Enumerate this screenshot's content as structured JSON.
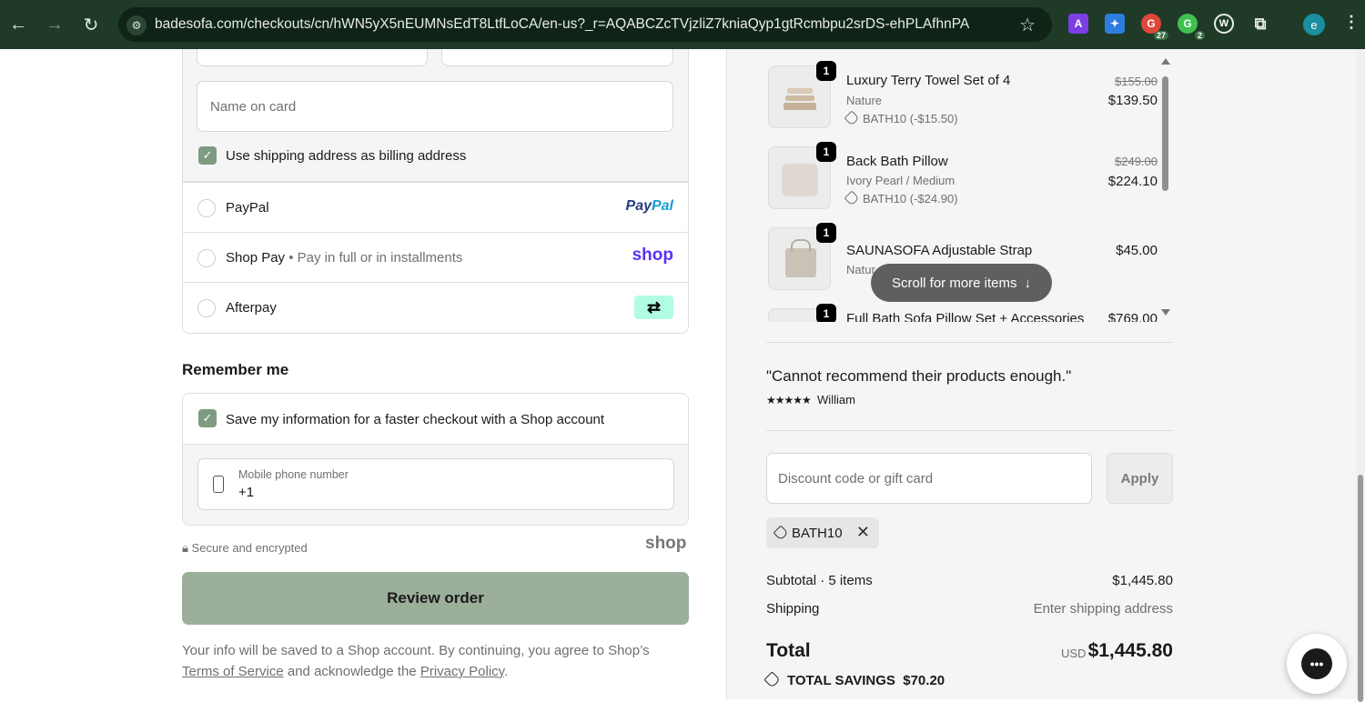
{
  "browser": {
    "url": "badesofa.com/checkouts/cn/hWN5yX5nEUMNsEdT8LtfLoCA/en-us?_r=AQABCZcTVjzliZ7kniaQyp1gtRcmbpu2srDS-ehPLAfhnPA",
    "ext_badge_1": "27",
    "ext_badge_2": "2",
    "profile_initial": "e"
  },
  "payment": {
    "name_on_card_placeholder": "Name on card",
    "billing_checkbox_label": "Use shipping address as billing address",
    "options": [
      {
        "label": "PayPal",
        "sub": "",
        "logo": "PayPal"
      },
      {
        "label": "Shop Pay",
        "sub": "• Pay in full or in installments",
        "logo": "shop"
      },
      {
        "label": "Afterpay",
        "sub": "",
        "logo": "afterpay"
      }
    ]
  },
  "remember": {
    "title": "Remember me",
    "checkbox_label": "Save my information for a faster checkout with a Shop account",
    "phone_label": "Mobile phone number",
    "phone_value": "+1"
  },
  "secure_text": "Secure and encrypted",
  "shop_logo_text": "shop",
  "review_button": "Review order",
  "legal": {
    "before": "Your info will be saved to a Shop account. By continuing, you agree to Shop’s ",
    "terms": "Terms of Service",
    "middle": " and acknowledge the ",
    "privacy": "Privacy Policy",
    "after": "."
  },
  "cart": {
    "items": [
      {
        "qty": "1",
        "name": "Luxury Terry Towel Set of 4",
        "variant": "Nature",
        "discount": "BATH10 (-$15.50)",
        "old_price": "$155.00",
        "price": "$139.50"
      },
      {
        "qty": "1",
        "name": "Back Bath Pillow",
        "variant": "Ivory Pearl / Medium",
        "discount": "BATH10 (-$24.90)",
        "old_price": "$249.00",
        "price": "$224.10"
      },
      {
        "qty": "1",
        "name": "SAUNASOFA Adjustable Strap",
        "variant": "Natur",
        "discount": "",
        "old_price": "",
        "price": "$45.00"
      },
      {
        "qty": "1",
        "name": "Full Bath Sofa Pillow Set + Accessories",
        "variant": "",
        "discount": "",
        "old_price": "",
        "price": "$769.00"
      }
    ],
    "scroll_hint": "Scroll for more items"
  },
  "testimonial": {
    "quote": "\"Cannot recommend their products enough.\"",
    "stars": "★★★★★",
    "author": "William"
  },
  "discount": {
    "placeholder": "Discount code or gift card",
    "apply_label": "Apply",
    "applied_code": "BATH10"
  },
  "summary": {
    "subtotal_label": "Subtotal · 5 items",
    "subtotal_value": "$1,445.80",
    "shipping_label": "Shipping",
    "shipping_value": "Enter shipping address",
    "total_label": "Total",
    "currency": "USD",
    "total_value": "$1,445.80",
    "savings_label": "TOTAL SAVINGS",
    "savings_value": "$70.20"
  }
}
